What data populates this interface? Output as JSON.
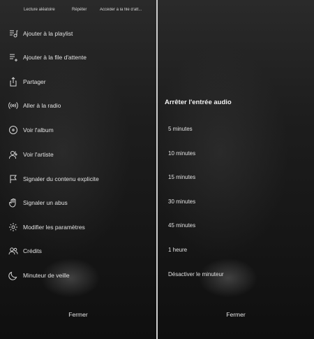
{
  "top_row": {
    "shuffle_label": "Lecture aléatoire",
    "repeat_label": "Répéter",
    "album_label": "Accéder à la file d'att..."
  },
  "menu": {
    "items": [
      {
        "label": "Ajouter à la playlist",
        "icon": "playlist-add-icon"
      },
      {
        "label": "Ajouter à la file d'attente",
        "icon": "queue-add-icon"
      },
      {
        "label": "Partager",
        "icon": "share-icon"
      },
      {
        "label": "Aller à la radio",
        "icon": "radio-icon"
      },
      {
        "label": "Voir l'album",
        "icon": "album-icon"
      },
      {
        "label": "Voir l'artiste",
        "icon": "artist-icon"
      },
      {
        "label": "Signaler du contenu explicite",
        "icon": "flag-icon"
      },
      {
        "label": "Signaler un abus",
        "icon": "hand-icon"
      },
      {
        "label": "Modifier les paramètres",
        "icon": "settings-icon"
      },
      {
        "label": "Crédits",
        "icon": "credits-icon"
      },
      {
        "label": "Minuteur de veille",
        "icon": "moon-icon"
      }
    ],
    "close_label": "Fermer"
  },
  "sleep_timer": {
    "title": "Arrêter l'entrée audio",
    "options": [
      "5 minutes",
      "10 minutes",
      "15 minutes",
      "30 minutes",
      "45 minutes",
      "1 heure",
      "Désactiver le minuteur"
    ],
    "close_label": "Fermer"
  },
  "colors": {
    "background": "#141414",
    "text": "#e2e2e2",
    "divider": "#cfcfcf"
  }
}
